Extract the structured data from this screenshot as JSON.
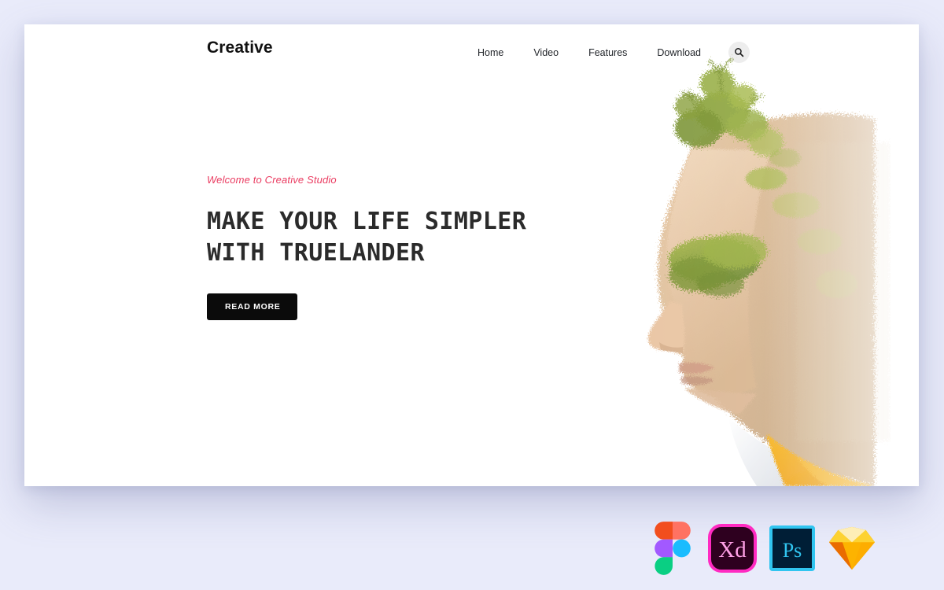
{
  "background": {
    "color": "#e9ebfa"
  },
  "page_card": {
    "background": "#ffffff"
  },
  "header": {
    "brand": "Creative",
    "nav_items": [
      {
        "label": "Home"
      },
      {
        "label": "Video"
      },
      {
        "label": "Features"
      },
      {
        "label": "Download"
      }
    ],
    "search": {
      "icon": "search-icon",
      "background": "#ededed"
    }
  },
  "hero": {
    "eyebrow": "Welcome to Creative Studio",
    "eyebrow_color": "#ea3b60",
    "title": "MAKE YOUR LIFE SIMPLER\nWITH TRUELANDER",
    "cta_label": "READ MORE",
    "cta_background": "#0b0b0b",
    "artwork": {
      "name": "double-exposure-portrait",
      "description": "Profile of a face blended with green foliage and trees, wearing a golden-yellow garment with white collar"
    }
  },
  "tools": [
    {
      "name": "figma-icon",
      "label": "Figma",
      "colors": [
        "#f24e1e",
        "#ff7262",
        "#a259ff",
        "#1abcfe",
        "#0acf83"
      ]
    },
    {
      "name": "adobe-xd-icon",
      "label": "Xd",
      "colors": [
        "#ff2bc2",
        "#2e001f",
        "#ffa0e6"
      ]
    },
    {
      "name": "photoshop-icon",
      "label": "Ps",
      "colors": [
        "#31c5f0",
        "#001e36",
        "#31c5f0"
      ]
    },
    {
      "name": "sketch-icon",
      "label": "Sketch",
      "colors": [
        "#fdb300",
        "#fdd231",
        "#feeeb7",
        "#ea6c00",
        "#fdad00"
      ]
    }
  ]
}
